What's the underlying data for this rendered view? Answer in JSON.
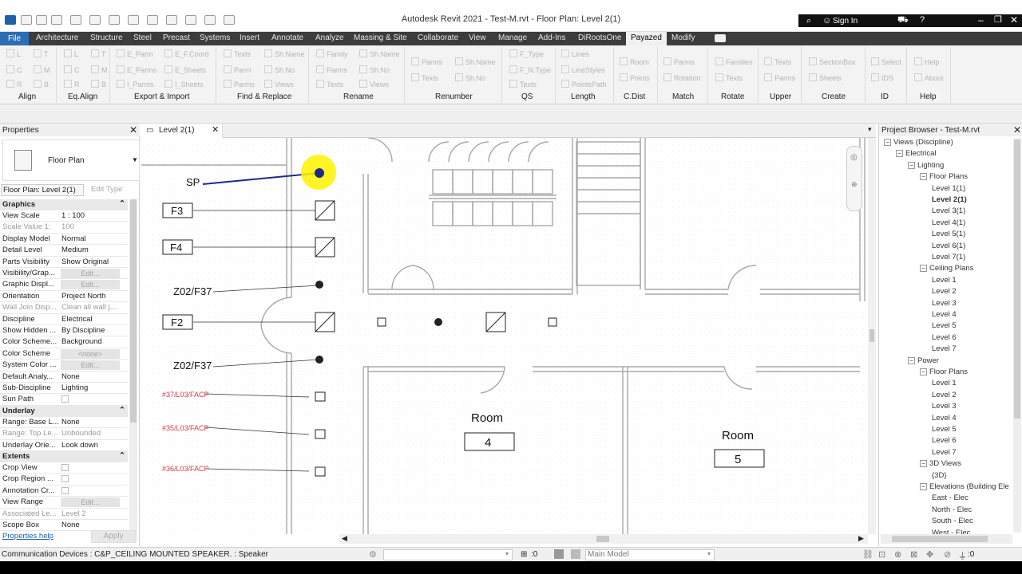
{
  "window": {
    "title": "Autodesk Revit 2021 - Test-M.rvt - Floor Plan: Level 2(1)",
    "sign_in": "Sign In"
  },
  "menu": {
    "file": "File",
    "tabs": [
      "Architecture",
      "Structure",
      "Steel",
      "Precast",
      "Systems",
      "Insert",
      "Annotate",
      "Analyze",
      "Massing & Site",
      "Collaborate",
      "View",
      "Manage",
      "Add-Ins",
      "DiRootsOne"
    ],
    "active": "Payazed",
    "after": "Modify"
  },
  "ribbon": {
    "panels": [
      "Align",
      "Eq.Align",
      "Export & Import",
      "Find & Replace",
      "Rename",
      "Renumber",
      "QS",
      "Length",
      "C.Dist",
      "Match",
      "Rotate",
      "Upper",
      "Create",
      "ID",
      "Help"
    ],
    "buttons": {
      "align": [
        "L",
        "T",
        "C",
        "M",
        "R",
        "B"
      ],
      "eqalign": [
        "L",
        "T",
        "C",
        "M",
        "R",
        "B"
      ],
      "export": [
        "E_Parm",
        "E_F.Coord",
        "E_Parms",
        "E_Sheets",
        "I_Parms",
        "I_Sheets"
      ],
      "find": [
        "Texts",
        "Sh.Name",
        "Parm",
        "Sh.No",
        "Parms",
        "Views"
      ],
      "rename": [
        "Family",
        "Sh.Name",
        "Parms",
        "Sh.No",
        "Texts",
        "Views"
      ],
      "renumber": [
        "Parms",
        "Sh.Name",
        "Texts",
        "Sh.No"
      ],
      "qs": [
        "F_Type",
        "F_N.Type",
        "Texts"
      ],
      "length": [
        "Lines",
        "LineStyles",
        "PointsPath"
      ],
      "cdist": [
        "Room",
        "Points"
      ],
      "match": [
        "Parms",
        "Rotation"
      ],
      "rotate": [
        "Families",
        "Texts"
      ],
      "upper": [
        "Texts",
        "Parms"
      ],
      "create": [
        "SectionBox",
        "Sheets"
      ],
      "id": [
        "Select",
        "IDS"
      ],
      "help": [
        "Help",
        "About"
      ]
    }
  },
  "properties": {
    "title": "Properties",
    "type": "Floor Plan",
    "instance": "Floor Plan: Level 2(1)",
    "edit_type": "Edit Type",
    "graphics": "Graphics",
    "rows": [
      {
        "k": "View Scale",
        "v": "1 : 100"
      },
      {
        "k": "Scale Value   1:",
        "v": "100",
        "gray": true
      },
      {
        "k": "Display Model",
        "v": "Normal"
      },
      {
        "k": "Detail Level",
        "v": "Medium"
      },
      {
        "k": "Parts Visibility",
        "v": "Show Original"
      },
      {
        "k": "Visibility/Grap...",
        "btn": "Edit..."
      },
      {
        "k": "Graphic Displ...",
        "btn": "Edit..."
      },
      {
        "k": "Orientation",
        "v": "Project North"
      },
      {
        "k": "Wall Join Disp...",
        "v": "Clean all wall j...",
        "gray": true
      },
      {
        "k": "Discipline",
        "v": "Electrical"
      },
      {
        "k": "Show Hidden ...",
        "v": "By Discipline"
      },
      {
        "k": "Color Scheme...",
        "v": "Background"
      },
      {
        "k": "Color Scheme",
        "btn": "<none>"
      },
      {
        "k": "System Color ...",
        "btn": "Edit..."
      },
      {
        "k": "Default Analy...",
        "v": "None"
      },
      {
        "k": "Sub-Discipline",
        "v": "Lighting"
      },
      {
        "k": "Sun Path",
        "chk": true
      }
    ],
    "underlay": "Underlay",
    "underlay_rows": [
      {
        "k": "Range: Base L...",
        "v": "None"
      },
      {
        "k": "Range: Top Le...",
        "v": "Unbounded",
        "gray": true
      },
      {
        "k": "Underlay Orie...",
        "v": "Look down"
      }
    ],
    "extents": "Extents",
    "extents_rows": [
      {
        "k": "Crop View",
        "chk": true
      },
      {
        "k": "Crop Region ...",
        "chk": true
      },
      {
        "k": "Annotation Cr...",
        "chk": true
      },
      {
        "k": "View Range",
        "btn": "Edit..."
      },
      {
        "k": "Associated Le...",
        "v": "Level 2",
        "gray": true
      },
      {
        "k": "Scope Box",
        "v": "None"
      }
    ],
    "help": "Properties help",
    "apply": "Apply"
  },
  "view": {
    "tab": "Level 2(1)",
    "tags": [
      "SP",
      "F3",
      "F4",
      "Z02/F37",
      "F2",
      "Z02/F37"
    ],
    "red_tags": [
      "#37/L03/FACP",
      "#35/L03/FACP",
      "#36/L03/FACP"
    ],
    "room_label": "Room",
    "rooms": [
      "4",
      "5"
    ]
  },
  "browser": {
    "title": "Project Browser - Test-M.rvt",
    "nodes": [
      {
        "t": "Views (Discipline)",
        "d": 0
      },
      {
        "t": "Electrical",
        "d": 1
      },
      {
        "t": "Lighting",
        "d": 2
      },
      {
        "t": "Floor Plans",
        "d": 3
      },
      {
        "t": "Level 1(1)",
        "d": 4
      },
      {
        "t": "Level 2(1)",
        "d": 4,
        "bold": true
      },
      {
        "t": "Level 3(1)",
        "d": 4
      },
      {
        "t": "Level 4(1)",
        "d": 4
      },
      {
        "t": "Level 5(1)",
        "d": 4
      },
      {
        "t": "Level 6(1)",
        "d": 4
      },
      {
        "t": "Level 7(1)",
        "d": 4
      },
      {
        "t": "Ceiling Plans",
        "d": 3
      },
      {
        "t": "Level 1",
        "d": 4
      },
      {
        "t": "Level 2",
        "d": 4
      },
      {
        "t": "Level 3",
        "d": 4
      },
      {
        "t": "Level 4",
        "d": 4
      },
      {
        "t": "Level 5",
        "d": 4
      },
      {
        "t": "Level 6",
        "d": 4
      },
      {
        "t": "Level 7",
        "d": 4
      },
      {
        "t": "Power",
        "d": 2
      },
      {
        "t": "Floor Plans",
        "d": 3
      },
      {
        "t": "Level 1",
        "d": 4
      },
      {
        "t": "Level 2",
        "d": 4
      },
      {
        "t": "Level 3",
        "d": 4
      },
      {
        "t": "Level 4",
        "d": 4
      },
      {
        "t": "Level 5",
        "d": 4
      },
      {
        "t": "Level 6",
        "d": 4
      },
      {
        "t": "Level 7",
        "d": 4
      },
      {
        "t": "3D Views",
        "d": 3
      },
      {
        "t": "{3D}",
        "d": 4
      },
      {
        "t": "Elevations (Building Ele",
        "d": 3
      },
      {
        "t": "East - Elec",
        "d": 4
      },
      {
        "t": "North - Elec",
        "d": 4
      },
      {
        "t": "South - Elec",
        "d": 4
      },
      {
        "t": "West - Elec",
        "d": 4
      }
    ]
  },
  "status": {
    "text": "Communication Devices : C&P_CEILING MOUNTED SPEAKER. : Speaker",
    "worksets": ":0",
    "model": "Main Model",
    "filter": ":0"
  }
}
